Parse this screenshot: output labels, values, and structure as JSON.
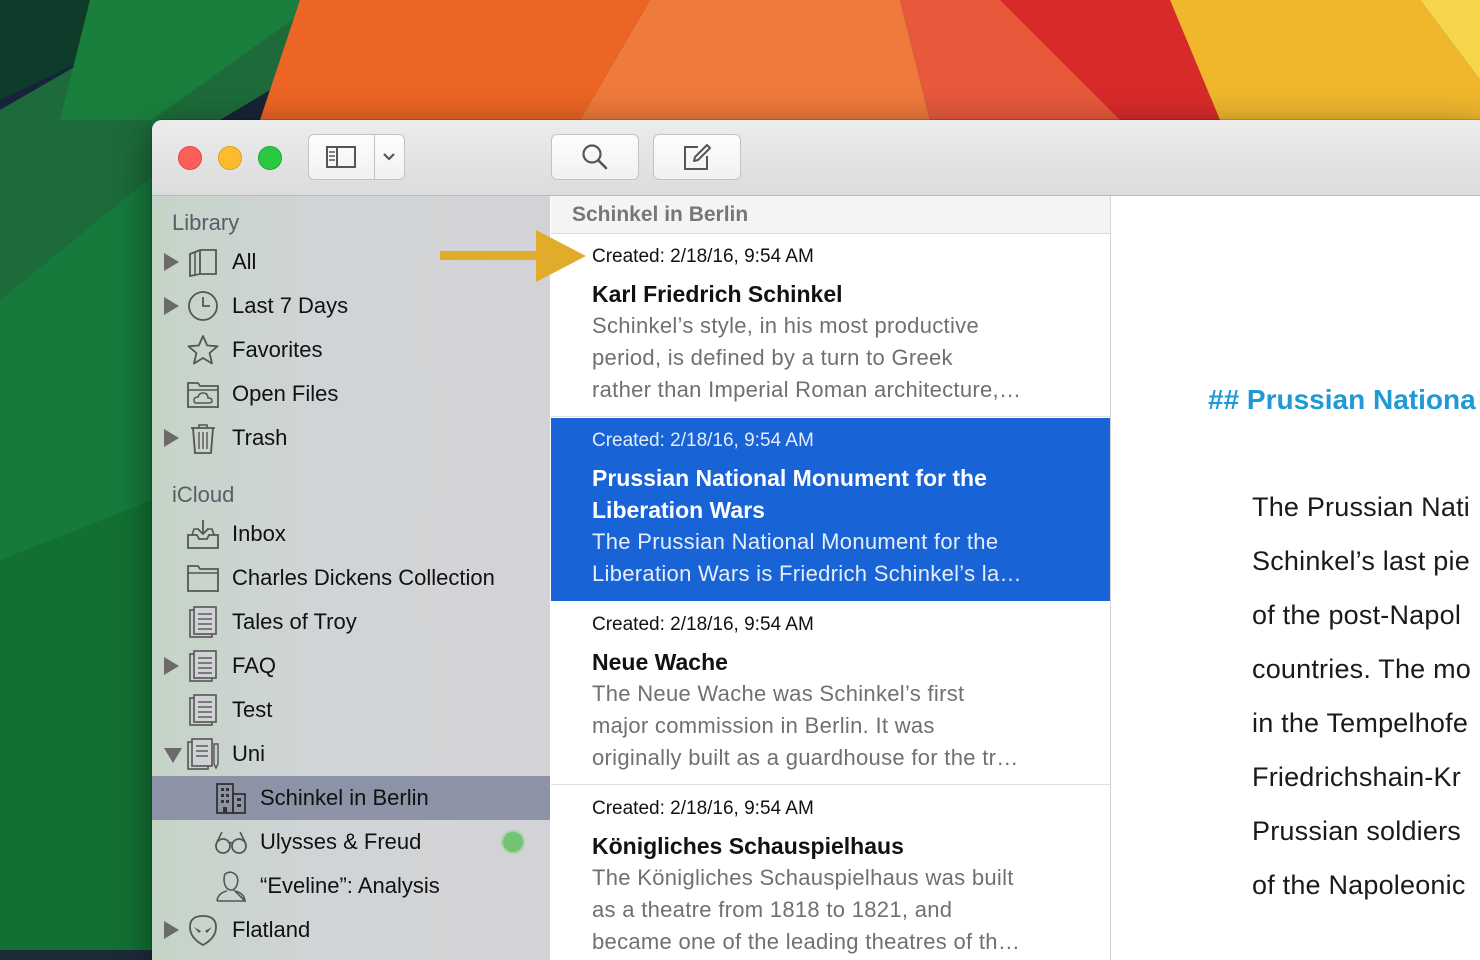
{
  "toolbar": {
    "sidebar_toggle_icon": "sidebar-icon",
    "dropdown_icon": "chevron-down-icon",
    "search_icon": "search-icon",
    "compose_icon": "compose-icon"
  },
  "sidebar": {
    "library_heading": "Library",
    "library_items": [
      {
        "label": "All",
        "icon": "books-icon",
        "expandable": true
      },
      {
        "label": "Last 7 Days",
        "icon": "clock-icon",
        "expandable": true
      },
      {
        "label": "Favorites",
        "icon": "star-icon",
        "expandable": false
      },
      {
        "label": "Open Files",
        "icon": "folder-cloud-icon",
        "expandable": false
      },
      {
        "label": "Trash",
        "icon": "trash-icon",
        "expandable": true
      }
    ],
    "icloud_heading": "iCloud",
    "icloud_items": [
      {
        "label": "Inbox",
        "icon": "inbox-icon"
      },
      {
        "label": "Charles Dickens Collection",
        "icon": "folder-icon"
      },
      {
        "label": "Tales of Troy",
        "icon": "document-stack-icon"
      },
      {
        "label": "FAQ",
        "icon": "document-stack-icon",
        "expandable": true
      },
      {
        "label": "Test",
        "icon": "document-stack-icon"
      },
      {
        "label": "Uni",
        "icon": "document-stack-pencil-icon",
        "expanded": true
      },
      {
        "label": "Schinkel in Berlin",
        "icon": "building-icon",
        "selected": true
      },
      {
        "label": "Ulysses & Freud",
        "icon": "glasses-icon",
        "badge": "sync-status-dot"
      },
      {
        "label": "“Eveline”: Analysis",
        "icon": "person-icon"
      },
      {
        "label": "Flatland",
        "icon": "alien-icon",
        "expandable": true
      }
    ]
  },
  "list": {
    "header": "Schinkel in Berlin",
    "notes": [
      {
        "date": "Created: 2/18/16, 9:54 AM",
        "title": "Karl Friedrich Schinkel",
        "excerpt_lines": [
          "Schinkel’s style, in his most productive",
          "period, is defined by a turn to Greek",
          "rather than Imperial Roman architecture,…"
        ]
      },
      {
        "date": "Created: 2/18/16, 9:54 AM",
        "title_lines": [
          "Prussian National Monument for the",
          "Liberation Wars"
        ],
        "excerpt_lines": [
          "The Prussian National Monument for the",
          "Liberation Wars is Friedrich Schinkel’s la…"
        ],
        "selected": true
      },
      {
        "date": "Created: 2/18/16, 9:54 AM",
        "title": "Neue Wache",
        "excerpt_lines": [
          "The Neue Wache was Schinkel’s first",
          "major commission in Berlin. It was",
          "originally built as a guardhouse for the tr…"
        ]
      },
      {
        "date": "Created: 2/18/16, 9:54 AM",
        "title": "Königliches Schauspielhaus",
        "excerpt_lines": [
          "The Königliches Schauspielhaus was built",
          "as a theatre from 1818 to 1821, and",
          "became one of the leading theatres of th…"
        ]
      }
    ]
  },
  "editor": {
    "heading": "## Prussian Nationa",
    "lines": [
      "The Prussian Nati",
      "Schinkel’s last pie",
      "of the post-Napol",
      "countries. The mo",
      "in the Tempelhofe",
      "Friedrichshain-Kr",
      "Prussian soldiers",
      "of the Napoleonic"
    ]
  },
  "colors": {
    "selection_blue": "#1863d6",
    "heading_blue": "#1f9ad6",
    "annotation_arrow": "#e2ac2b",
    "sidebar_selection": "#8c93a6"
  }
}
